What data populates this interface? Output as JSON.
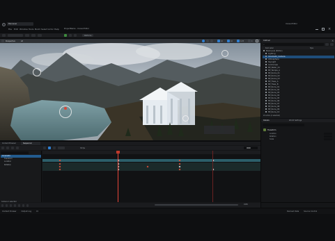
{
  "window": {
    "project_tab": "ProjectName - Unreal Editor",
    "level_tab": "MainLevel",
    "right_title": "Unreal Editor"
  },
  "menu": [
    "File",
    "Edit",
    "Window",
    "Tools",
    "Build",
    "Select",
    "Actor",
    "Help"
  ],
  "toolbar": {
    "save_label": "",
    "mode_label": "Selection Mode",
    "platforms_label": "Platforms"
  },
  "viewport": {
    "perspective_label": "Perspective",
    "lit_label": "Lit",
    "grid_value": "10",
    "angle_value": "10",
    "scale_value": "0.25",
    "camera_speed": "4"
  },
  "outliner": {
    "tab_label": "Outliner",
    "search_placeholder": "Search...",
    "col_label": "Item Label",
    "col_type": "Type",
    "items": [
      {
        "label": "MainLevel (Editor)",
        "selected": false
      },
      {
        "label": "Lighting",
        "selected": false
      },
      {
        "label": "Cinematic_Camera",
        "selected": true
      },
      {
        "label": "Atmosphere",
        "selected": false
      },
      {
        "label": "SkyLight",
        "selected": false
      },
      {
        "label": "Landscape",
        "selected": false
      },
      {
        "label": "BP_Water_01",
        "selected": false
      },
      {
        "label": "BP_Temple_A",
        "selected": false
      },
      {
        "label": "BP_Rocks_01",
        "selected": false
      },
      {
        "label": "BP_Rocks_02",
        "selected": false
      },
      {
        "label": "BP_Rocks_03",
        "selected": false
      },
      {
        "label": "BP_Trees_A",
        "selected": false
      },
      {
        "label": "BP_Trees_B",
        "selected": false
      },
      {
        "label": "BP_Ruins_01",
        "selected": false
      },
      {
        "label": "BP_Ruins_02",
        "selected": false
      },
      {
        "label": "BP_Ruins_03",
        "selected": false
      },
      {
        "label": "BP_Ruins_04",
        "selected": false
      },
      {
        "label": "BP_Ruins_05",
        "selected": false
      },
      {
        "label": "BP_Ruins_06",
        "selected": false
      },
      {
        "label": "BP_Ruins_07",
        "selected": false
      },
      {
        "label": "BP_Ruins_08",
        "selected": false
      },
      {
        "label": "BP_Ruins_09",
        "selected": false
      },
      {
        "label": "BP_Ruins_10",
        "selected": false
      }
    ],
    "footer": "24 actors (1 selected)"
  },
  "details": {
    "tab_label": "Details",
    "tab2_label": "World Settings",
    "section": "Transform",
    "rows": [
      "Location",
      "Rotation",
      "Scale"
    ]
  },
  "sequencer": {
    "tab1": "Content Browser",
    "tab2": "Sequencer",
    "fps": "30 fps",
    "current_frame": "0000",
    "tracks": [
      {
        "label": "Cinematic",
        "selected": true
      },
      {
        "label": "Transform",
        "selected": false
      },
      {
        "label": "Location",
        "selected": false
      },
      {
        "label": "Rotation",
        "selected": false
      }
    ],
    "end_frame": "0150",
    "status": "Camera 1 selected"
  },
  "statusbar": {
    "items": [
      "Content Drawer",
      "Output Log",
      "Cmd"
    ],
    "right": [
      "Derived Data",
      "Source Control"
    ]
  }
}
